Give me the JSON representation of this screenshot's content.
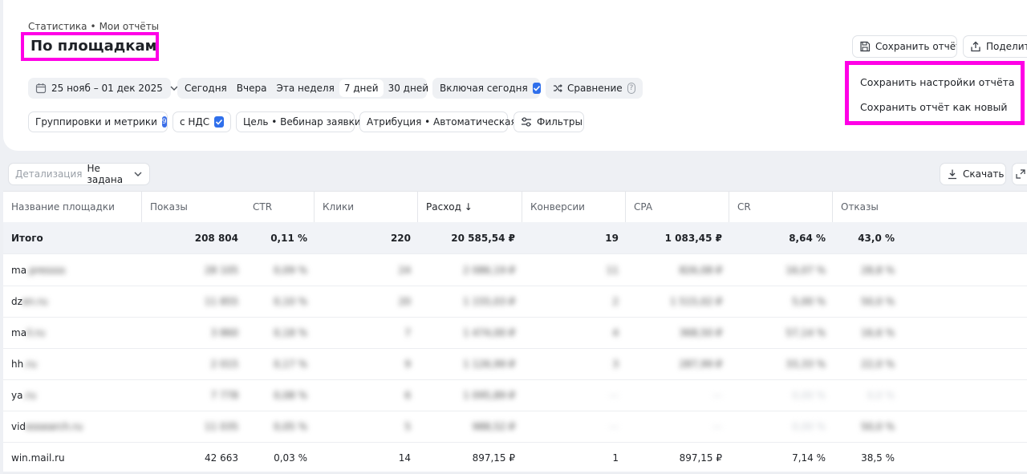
{
  "breadcrumb": {
    "root": "Статистика",
    "separator": "•",
    "current": "Мои отчёты"
  },
  "title": "По площадкам",
  "toolbar": {
    "date_range": "25 нояб – 01 дек 2025",
    "periods": [
      "Сегодня",
      "Вчера",
      "Эта неделя",
      "7 дней",
      "30 дней"
    ],
    "active_period": "7 дней",
    "include_today": {
      "label": "Включая сегодня",
      "checked": true
    },
    "compare": "Сравнение",
    "groupings": {
      "label": "Группировки и метрики",
      "count": "9"
    },
    "vat": {
      "label": "с НДС",
      "checked": true
    },
    "goal": "Цель • Вебинар заявки",
    "attribution": "Атрибуция • Автоматическая",
    "filters": "Фильтры"
  },
  "actions": {
    "save": "Сохранить отчёт",
    "share": "Поделиться",
    "menu": [
      "Сохранить настройки отчёта",
      "Сохранить отчёт как новый"
    ]
  },
  "detail": {
    "label": "Детализация",
    "value": "Не задана"
  },
  "download": "Скачать",
  "table": {
    "columns": [
      "Название площадки",
      "Показы",
      "CTR",
      "Клики",
      "Расход ↓",
      "Конверсии",
      "CPA",
      "CR",
      "Отказы"
    ],
    "total": [
      "Итого",
      "208 804",
      "0,11 %",
      "220",
      "20 585,54 ₽",
      "19",
      "1 083,45 ₽",
      "8,64 %",
      "43,0 %"
    ],
    "rows": [
      {
        "name": "ma",
        "blurred": true
      },
      {
        "name": "dz",
        "blurred": true
      },
      {
        "name": "ma",
        "blurred": true
      },
      {
        "name": "hh",
        "blurred": true
      },
      {
        "name": "ya",
        "blurred": true
      },
      {
        "name": "vid",
        "blurred": true
      },
      {
        "name": "win.mail.ru",
        "blurred": false,
        "values": [
          "42 663",
          "0,03 %",
          "14",
          "897,15 ₽",
          "1",
          "897,15 ₽",
          "7,14 %",
          "38,5 %"
        ]
      }
    ]
  },
  "colors": {
    "highlight": "#ff00e6",
    "accent": "#2f6feb"
  }
}
